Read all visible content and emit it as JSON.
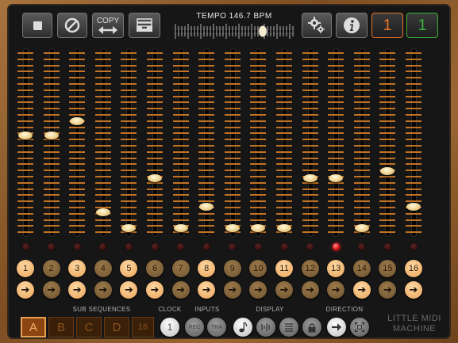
{
  "app": {
    "brand_line1": "LITTLE MIDI",
    "brand_line2": "MACHINE"
  },
  "toolbar": {
    "stop_icon": "stop-icon",
    "clear_icon": "cancel-icon",
    "copy_label": "COPY",
    "copy_icon": "left-right-arrow-icon",
    "storage_icon": "tray-icon",
    "tempo_label": "TEMPO 146.7 BPM",
    "tempo_bpm": 146.7,
    "settings_icon": "gear-icon",
    "info_icon": "info-icon",
    "channel_a": "1",
    "channel_b": "1",
    "channel_a_color": "#e8732a",
    "channel_b_color": "#3ab03a"
  },
  "steps": [
    {
      "number": "1",
      "level": 0.54,
      "number_lit": true,
      "direction_lit": true,
      "led_on": false
    },
    {
      "number": "2",
      "level": 0.54,
      "number_lit": false,
      "direction_lit": false,
      "led_on": false
    },
    {
      "number": "3",
      "level": 0.62,
      "number_lit": true,
      "direction_lit": true,
      "led_on": false
    },
    {
      "number": "4",
      "level": 0.11,
      "number_lit": false,
      "direction_lit": false,
      "led_on": false
    },
    {
      "number": "5",
      "level": 0.02,
      "number_lit": true,
      "direction_lit": true,
      "led_on": false
    },
    {
      "number": "6",
      "level": 0.3,
      "number_lit": false,
      "direction_lit": true,
      "led_on": false
    },
    {
      "number": "7",
      "level": 0.02,
      "number_lit": false,
      "direction_lit": false,
      "led_on": false
    },
    {
      "number": "8",
      "level": 0.14,
      "number_lit": true,
      "direction_lit": true,
      "led_on": false
    },
    {
      "number": "9",
      "level": 0.02,
      "number_lit": false,
      "direction_lit": false,
      "led_on": false
    },
    {
      "number": "10",
      "level": 0.02,
      "number_lit": false,
      "direction_lit": false,
      "led_on": false
    },
    {
      "number": "11",
      "level": 0.02,
      "number_lit": true,
      "direction_lit": false,
      "led_on": false
    },
    {
      "number": "12",
      "level": 0.3,
      "number_lit": false,
      "direction_lit": false,
      "led_on": false
    },
    {
      "number": "13",
      "level": 0.3,
      "number_lit": true,
      "direction_lit": false,
      "led_on": true
    },
    {
      "number": "14",
      "level": 0.02,
      "number_lit": false,
      "direction_lit": true,
      "led_on": false
    },
    {
      "number": "15",
      "level": 0.34,
      "number_lit": false,
      "direction_lit": false,
      "led_on": false
    },
    {
      "number": "16",
      "level": 0.14,
      "number_lit": true,
      "direction_lit": true,
      "led_on": false
    }
  ],
  "direction_arrow": "➔",
  "bottom": {
    "sub_sequences_label": "SUB SEQUENCES",
    "sub_sequences": [
      "A",
      "B",
      "C",
      "D"
    ],
    "sub_active": "A",
    "sub_length": "16",
    "clock_label": "CLOCK",
    "clock_value": "1",
    "inputs_label": "INPUTS",
    "input_rec": "REC",
    "input_tra": "TRA",
    "display_label": "DISPLAY",
    "display_icons": [
      "note-icon",
      "velocity-icon",
      "lines-icon",
      "lock-icon"
    ],
    "direction_label": "DIRECTION",
    "direction_icons": [
      "arrow-right-icon",
      "random-icon"
    ]
  }
}
